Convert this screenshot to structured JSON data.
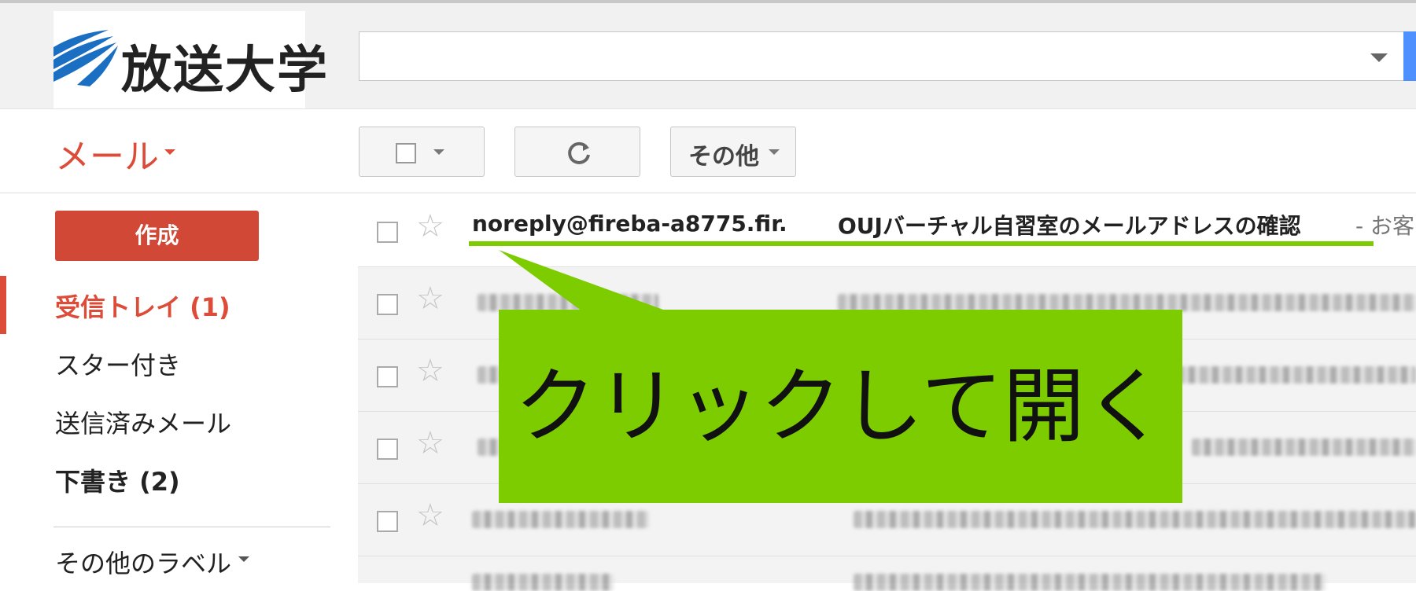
{
  "header": {
    "logo_text": "放送大学",
    "search": {
      "value": "",
      "placeholder": ""
    }
  },
  "toolbar": {
    "mail_label": "メール",
    "other_label": "その他"
  },
  "sidebar": {
    "compose_label": "作成",
    "items": [
      {
        "label": "受信トレイ (1)",
        "active": true
      },
      {
        "label": "スター付き"
      },
      {
        "label": "送信済みメール"
      },
      {
        "label": "下書き (2)",
        "bold": true
      }
    ],
    "more_labels": "その他のラベル"
  },
  "messages": [
    {
      "sender": "noreply@fireba-a8775.fir.",
      "subject": "OUJバーチャル自習室のメールアドレスの確認",
      "snippet": "- お客",
      "unread": true
    }
  ],
  "annotation": {
    "text": "クリックして開く",
    "color": "#7ccc00"
  },
  "colors": {
    "accent_red": "#dd4b39",
    "compose_red": "#d14836",
    "search_blue": "#4d90fe"
  }
}
